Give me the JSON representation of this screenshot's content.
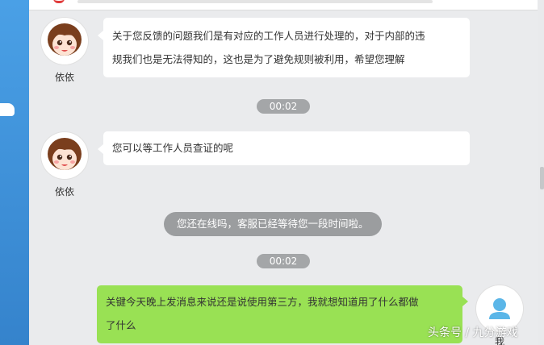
{
  "messages": [
    {
      "sender": "依依",
      "lines": [
        "关于您反馈的问题我们是有对应的工作人员进行处理的，对于内部的违",
        "规我们也是无法得知的，这也是为了避免规则被利用，希望您理解"
      ]
    },
    {
      "timestamp": "00:02"
    },
    {
      "sender": "依依",
      "lines": [
        "您可以等工作人员查证的呢"
      ]
    },
    {
      "system": "您还在线吗，客服已经等待您一段时间啦。"
    },
    {
      "timestamp": "00:02"
    },
    {
      "sender": "我",
      "lines": [
        "关键今天晚上发消息来说还是说使用第三方，我就想知道用了什么都做",
        "了什么"
      ]
    }
  ],
  "watermark": "头条号 / 九分游戏",
  "colors": {
    "agent_bubble": "#ffffff",
    "user_bubble": "#99e154",
    "pill": "#9b9d9f",
    "chat_background": "#eaebed"
  },
  "icons": {
    "agent_avatar": "cartoon-girl-avatar-icon",
    "user_avatar": "default-user-avatar-icon"
  }
}
